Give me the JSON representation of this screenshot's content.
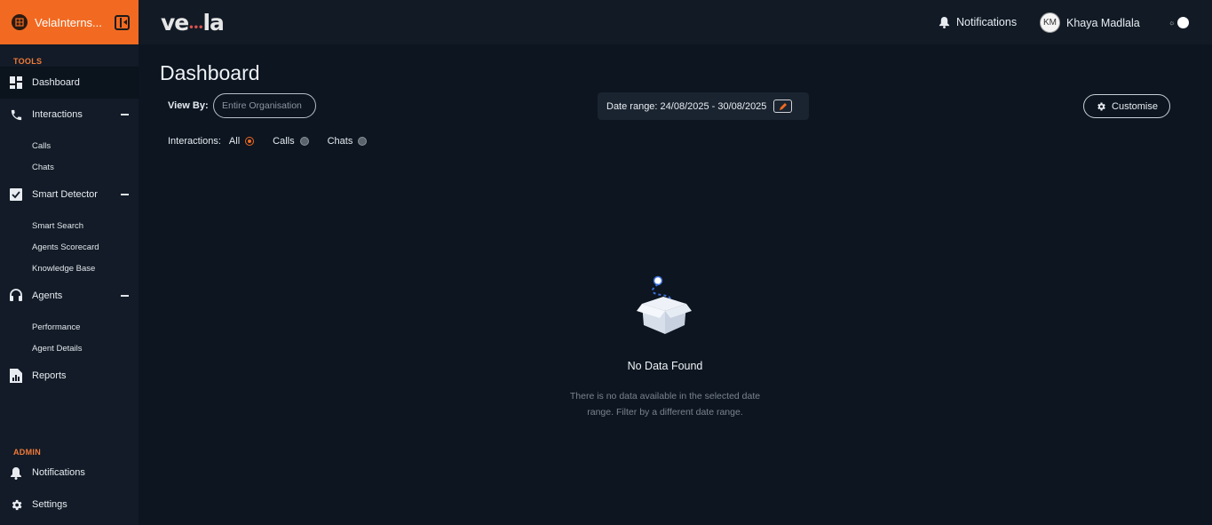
{
  "org": {
    "name": "VelaInterns..."
  },
  "brand": {
    "logo_text_left": "ve",
    "logo_text_right": "la"
  },
  "sidebar": {
    "tools_label": "TOOLS",
    "admin_label": "ADMIN",
    "items": {
      "dashboard": "Dashboard",
      "interactions": "Interactions",
      "calls": "Calls",
      "chats": "Chats",
      "smart_detector": "Smart Detector",
      "smart_search": "Smart Search",
      "agents_scorecard": "Agents Scorecard",
      "knowledge_base": "Knowledge Base",
      "agents": "Agents",
      "performance": "Performance",
      "agent_details": "Agent Details",
      "reports": "Reports",
      "notifications": "Notifications",
      "settings": "Settings"
    }
  },
  "header": {
    "notifications_label": "Notifications",
    "user_initials": "KM",
    "user_name": "Khaya Madlala"
  },
  "main": {
    "title": "Dashboard",
    "view_by_label": "View By:",
    "view_by_placeholder": "Entire Organisation",
    "date_range": "Date range: 24/08/2025 - 30/08/2025",
    "customise_label": "Customise",
    "interactions_label": "Interactions:",
    "interaction_options": [
      {
        "label": "All",
        "selected": true
      },
      {
        "label": "Calls",
        "selected": false
      },
      {
        "label": "Chats",
        "selected": false
      }
    ],
    "empty_title": "No Data Found",
    "empty_line1": "There is no data available in the selected date",
    "empty_line2": "range. Filter by a different date range."
  },
  "colors": {
    "accent": "#f26a21",
    "background": "#0c1520",
    "sidebar": "#121b27"
  }
}
